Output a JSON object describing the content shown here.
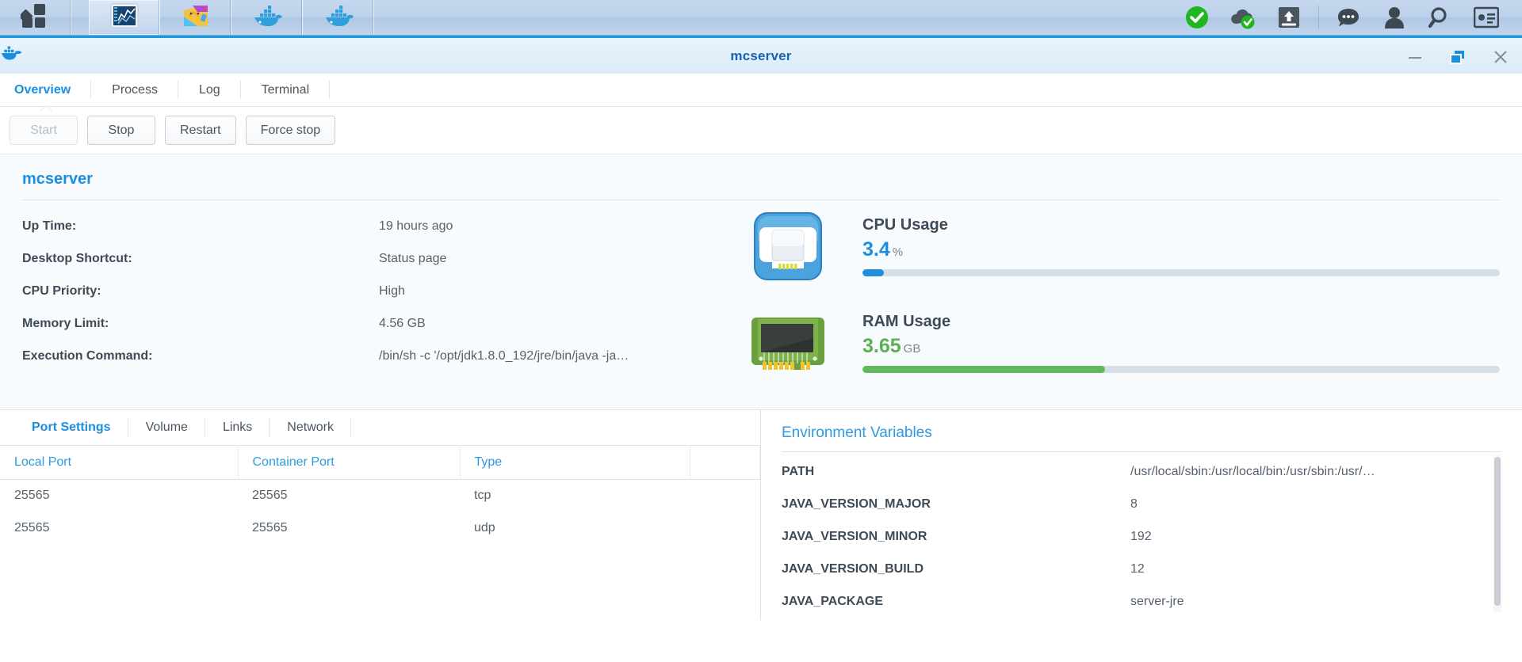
{
  "taskbar": {
    "left_items": [
      {
        "name": "main-menu",
        "icon": "grid-apps-icon"
      },
      {
        "name": "resource-monitor",
        "icon": "chart-monitor-icon",
        "active": true
      },
      {
        "name": "package-center",
        "icon": "shopping-bag-icon"
      },
      {
        "name": "docker-window-1",
        "icon": "docker-whale-icon"
      },
      {
        "name": "docker-window-2",
        "icon": "docker-whale-icon"
      }
    ],
    "right_items": [
      {
        "name": "status-ok",
        "icon": "green-check-icon"
      },
      {
        "name": "cloud-sync-status",
        "icon": "cloud-check-icon"
      },
      {
        "name": "upload-status",
        "icon": "upload-drive-icon"
      },
      {
        "name": "notifications",
        "icon": "chat-bubble-icon"
      },
      {
        "name": "user-account",
        "icon": "person-icon"
      },
      {
        "name": "search",
        "icon": "magnifier-icon"
      },
      {
        "name": "widgets",
        "icon": "widget-panel-icon"
      }
    ]
  },
  "window": {
    "title": "mcserver",
    "app_icon": "docker-whale-icon",
    "controls": {
      "minimize": "minimize-icon",
      "restore": "restore-icon",
      "close": "close-icon"
    }
  },
  "tabs": [
    {
      "label": "Overview",
      "active": true
    },
    {
      "label": "Process",
      "active": false
    },
    {
      "label": "Log",
      "active": false
    },
    {
      "label": "Terminal",
      "active": false
    }
  ],
  "actions": [
    {
      "label": "Start",
      "disabled": true
    },
    {
      "label": "Stop",
      "disabled": false
    },
    {
      "label": "Restart",
      "disabled": false
    },
    {
      "label": "Force stop",
      "disabled": false
    }
  ],
  "overview": {
    "heading": "mcserver",
    "rows": [
      {
        "label": "Up Time:",
        "value": "19 hours ago"
      },
      {
        "label": "Desktop Shortcut:",
        "value": "Status page"
      },
      {
        "label": "CPU Priority:",
        "value": "High"
      },
      {
        "label": "Memory Limit:",
        "value": "4.56 GB"
      },
      {
        "label": "Execution Command:",
        "value": "/bin/sh -c '/opt/jdk1.8.0_192/jre/bin/java -ja…"
      }
    ],
    "cpu": {
      "title": "CPU Usage",
      "value": "3.4",
      "unit": "%",
      "percent": 3.4,
      "color": "#1f8fdd",
      "icon": "cpu-chip-icon"
    },
    "ram": {
      "title": "RAM Usage",
      "value": "3.65",
      "unit": "GB",
      "percent": 38,
      "color": "#64b85c",
      "icon": "ram-stick-icon"
    }
  },
  "port_panel": {
    "tabs": [
      {
        "label": "Port Settings",
        "active": true
      },
      {
        "label": "Volume",
        "active": false
      },
      {
        "label": "Links",
        "active": false
      },
      {
        "label": "Network",
        "active": false
      }
    ],
    "columns": [
      "Local Port",
      "Container Port",
      "Type"
    ],
    "rows": [
      {
        "local": "25565",
        "container": "25565",
        "type": "tcp"
      },
      {
        "local": "25565",
        "container": "25565",
        "type": "udp"
      }
    ]
  },
  "env_panel": {
    "title": "Environment Variables",
    "rows": [
      {
        "key": "PATH",
        "value": "/usr/local/sbin:/usr/local/bin:/usr/sbin:/usr/…"
      },
      {
        "key": "JAVA_VERSION_MAJOR",
        "value": "8"
      },
      {
        "key": "JAVA_VERSION_MINOR",
        "value": "192"
      },
      {
        "key": "JAVA_VERSION_BUILD",
        "value": "12"
      },
      {
        "key": "JAVA_PACKAGE",
        "value": "server-jre"
      }
    ]
  }
}
